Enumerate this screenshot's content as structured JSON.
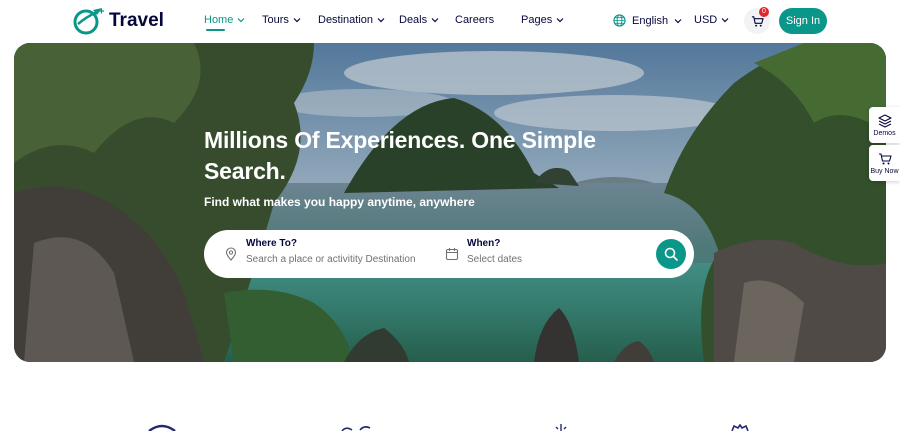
{
  "brand": {
    "name": "Travel",
    "color": "#0a9688",
    "icon": "globe-plane-icon"
  },
  "nav": {
    "items": [
      {
        "label": "Home",
        "active": true,
        "dropdown": true
      },
      {
        "label": "Tours",
        "active": false,
        "dropdown": true
      },
      {
        "label": "Destination",
        "active": false,
        "dropdown": true
      },
      {
        "label": "Deals",
        "active": false,
        "dropdown": true
      },
      {
        "label": "Careers",
        "active": false,
        "dropdown": false
      },
      {
        "label": "Pages",
        "active": false,
        "dropdown": true
      }
    ]
  },
  "header": {
    "language": "English",
    "currency": "USD",
    "cart_count": "0",
    "signin_label": "Sign In"
  },
  "hero": {
    "title": "Millions Of Experiences. One Simple Search.",
    "subtitle": "Find what makes you happy anytime, anywhere"
  },
  "search": {
    "where_label": "Where To?",
    "where_placeholder": "Search a place or activitity Destination",
    "when_label": "When?",
    "when_placeholder": "Select dates"
  },
  "side": {
    "demos_label": "Demos",
    "buy_label": "Buy Now"
  },
  "colors": {
    "accent": "#0a9688",
    "text": "#05073c",
    "badge": "#e4252d"
  }
}
